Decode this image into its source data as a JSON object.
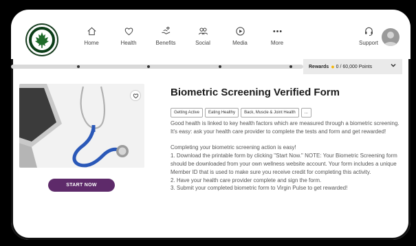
{
  "nav": {
    "items": [
      {
        "label": "Home",
        "icon": "home-icon"
      },
      {
        "label": "Health",
        "icon": "heart-icon"
      },
      {
        "label": "Benefits",
        "icon": "benefits-icon"
      },
      {
        "label": "Social",
        "icon": "social-icon"
      },
      {
        "label": "Media",
        "icon": "play-icon"
      },
      {
        "label": "More",
        "icon": "more-dots-icon"
      }
    ],
    "support_label": "Support"
  },
  "rewards": {
    "label": "Rewards",
    "points": "0 / 60,000 Points"
  },
  "activity": {
    "title": "Biometric Screening Verified Form",
    "tags": [
      "Getting Active",
      "Eating Healthy",
      "Back, Muscle & Joint Health",
      "..."
    ],
    "intro": "Good health is linked to key health factors which are measured through a biometric screening. It's easy: ask your health care provider to complete the tests and form and get rewarded!",
    "steps_heading": "Completing your biometric screening action is easy!",
    "step1": "1. Download the printable form by clicking \"Start Now.\" NOTE: Your Biometric Screening form should be downloaded from your own wellness website account. Your form includes a unique Member ID that is used to make sure you receive credit for completing this activity.",
    "step2": "2. Have your health care provider complete and sign the form.",
    "step3": "3. Submit your completed biometric form to Virgin Pulse to get rewarded!",
    "start_button": "START NOW"
  },
  "colors": {
    "accent": "#5e2a6a",
    "star": "#f5b400",
    "logo_bg": "#0b3d17"
  }
}
